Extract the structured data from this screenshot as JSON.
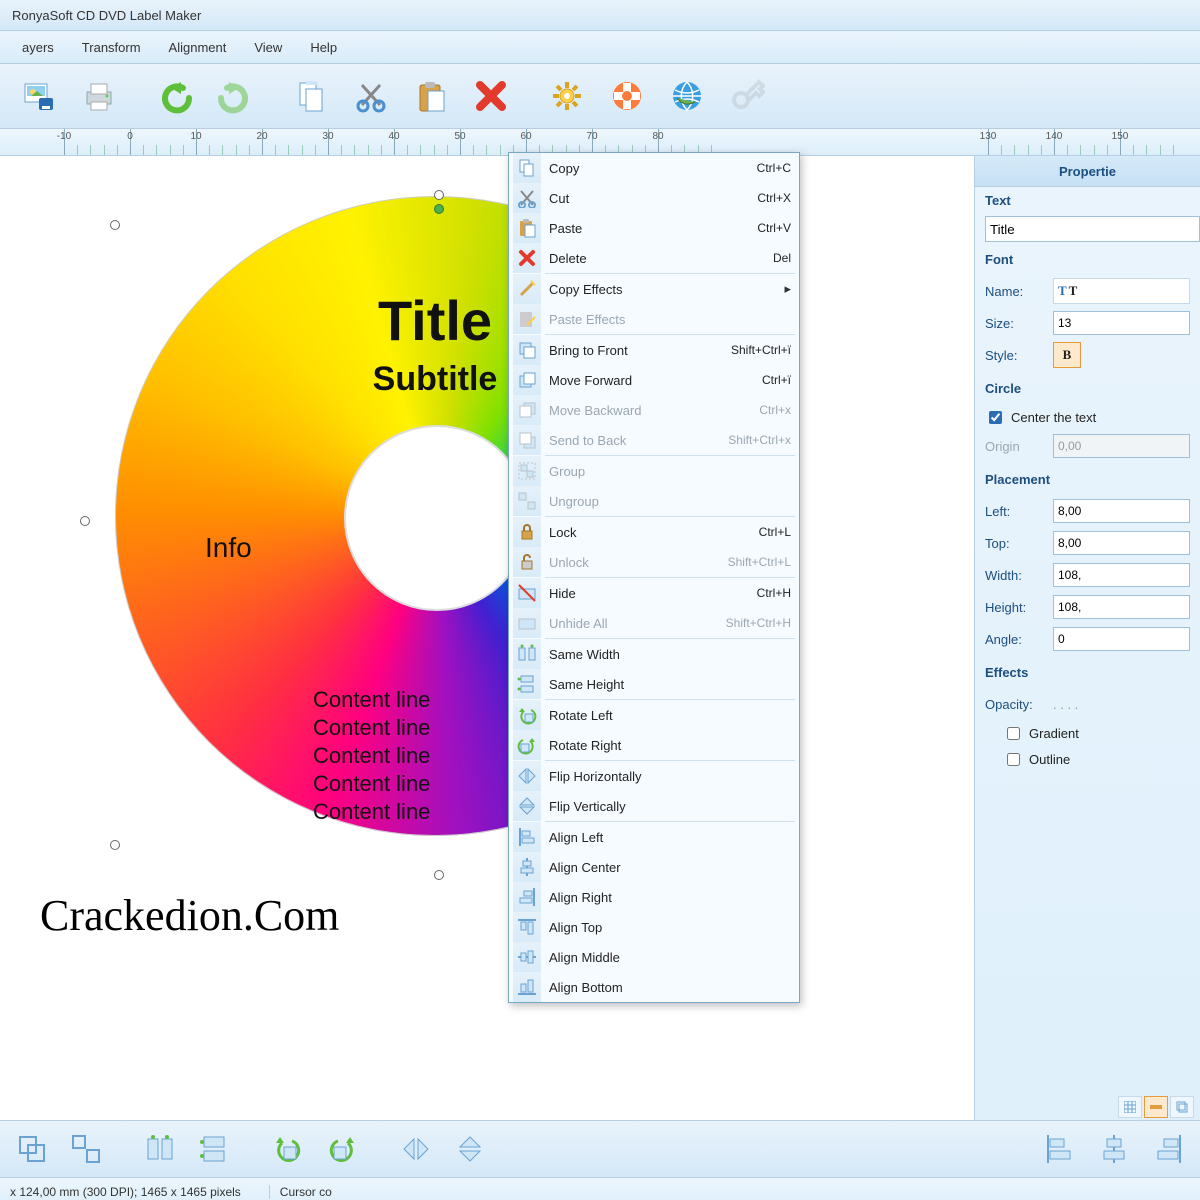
{
  "app": {
    "title": "RonyaSoft CD DVD Label Maker"
  },
  "menu": {
    "items": [
      "ayers",
      "Transform",
      "Alignment",
      "View",
      "Help"
    ]
  },
  "ruler": {
    "marks": [
      -10,
      0,
      10,
      20,
      30,
      40,
      50,
      60,
      70,
      80,
      130,
      140,
      150
    ]
  },
  "context_menu": [
    {
      "icon": "copy",
      "label": "Copy",
      "shortcut": "Ctrl+C",
      "sep": false
    },
    {
      "icon": "cut",
      "label": "Cut",
      "shortcut": "Ctrl+X",
      "sep": false
    },
    {
      "icon": "paste",
      "label": "Paste",
      "shortcut": "Ctrl+V",
      "sep": false
    },
    {
      "icon": "delete",
      "label": "Delete",
      "shortcut": "Del",
      "sep": true
    },
    {
      "icon": "wand",
      "label": "Copy Effects",
      "submenu": true,
      "sep": false
    },
    {
      "icon": "paste-fx",
      "label": "Paste Effects",
      "disabled": true,
      "sep": true
    },
    {
      "icon": "front",
      "label": "Bring to Front",
      "shortcut": "Shift+Ctrl+ï",
      "sep": false
    },
    {
      "icon": "fwd",
      "label": "Move Forward",
      "shortcut": "Ctrl+ï",
      "sep": false
    },
    {
      "icon": "bwd",
      "label": "Move Backward",
      "shortcut": "Ctrl+x",
      "disabled": true,
      "sep": false
    },
    {
      "icon": "back",
      "label": "Send to Back",
      "shortcut": "Shift+Ctrl+x",
      "disabled": true,
      "sep": true
    },
    {
      "icon": "group",
      "label": "Group",
      "disabled": true,
      "sep": false
    },
    {
      "icon": "ungroup",
      "label": "Ungroup",
      "disabled": true,
      "sep": true
    },
    {
      "icon": "lock",
      "label": "Lock",
      "shortcut": "Ctrl+L",
      "sep": false
    },
    {
      "icon": "unlock",
      "label": "Unlock",
      "shortcut": "Shift+Ctrl+L",
      "disabled": true,
      "sep": true
    },
    {
      "icon": "hide",
      "label": "Hide",
      "shortcut": "Ctrl+H",
      "sep": false
    },
    {
      "icon": "unhide",
      "label": "Unhide All",
      "shortcut": "Shift+Ctrl+H",
      "disabled": true,
      "sep": true
    },
    {
      "icon": "samew",
      "label": "Same Width",
      "sep": false
    },
    {
      "icon": "sameh",
      "label": "Same Height",
      "sep": true
    },
    {
      "icon": "rotl",
      "label": "Rotate Left",
      "sep": false
    },
    {
      "icon": "rotr",
      "label": "Rotate Right",
      "sep": true
    },
    {
      "icon": "fliph",
      "label": "Flip Horizontally",
      "sep": false
    },
    {
      "icon": "flipv",
      "label": "Flip Vertically",
      "sep": true
    },
    {
      "icon": "alignl",
      "label": "Align Left",
      "sep": false
    },
    {
      "icon": "alignc",
      "label": "Align Center",
      "sep": false
    },
    {
      "icon": "alignr",
      "label": "Align Right",
      "sep": false
    },
    {
      "icon": "alignt",
      "label": "Align Top",
      "sep": false
    },
    {
      "icon": "alignm",
      "label": "Align Middle",
      "sep": false
    },
    {
      "icon": "alignb",
      "label": "Align Bottom",
      "sep": false
    }
  ],
  "disc": {
    "title": "Title",
    "subtitle": "Subtitle",
    "info": "Info",
    "content": [
      "Content line",
      "Content line",
      "Content line",
      "Content line",
      "Content line"
    ]
  },
  "watermark": "Crackedion.Com",
  "properties": {
    "panel_title": "Propertie",
    "text_section": "Text",
    "text_value": "Title",
    "font_section": "Font",
    "font_name_label": "Name:",
    "font_name_value": "T",
    "font_size_label": "Size:",
    "font_size_value": "13",
    "font_style_label": "Style:",
    "font_style_value": "B",
    "circle_section": "Circle",
    "circle_center_label": "Center the text",
    "circle_origin_label": "Origin",
    "circle_origin_value": "0,00",
    "placement_section": "Placement",
    "left_label": "Left:",
    "left_value": "8,00",
    "top_label": "Top:",
    "top_value": "8,00",
    "width_label": "Width:",
    "width_value": "108,",
    "height_label": "Height:",
    "height_value": "108,",
    "angle_label": "Angle:",
    "angle_value": "0",
    "effects_section": "Effects",
    "opacity_label": "Opacity:",
    "gradient_label": "Gradient",
    "outline_label": "Outline"
  },
  "status": {
    "doc": "x 124,00 mm (300 DPI); 1465 x 1465 pixels",
    "cursor": "Cursor co"
  }
}
